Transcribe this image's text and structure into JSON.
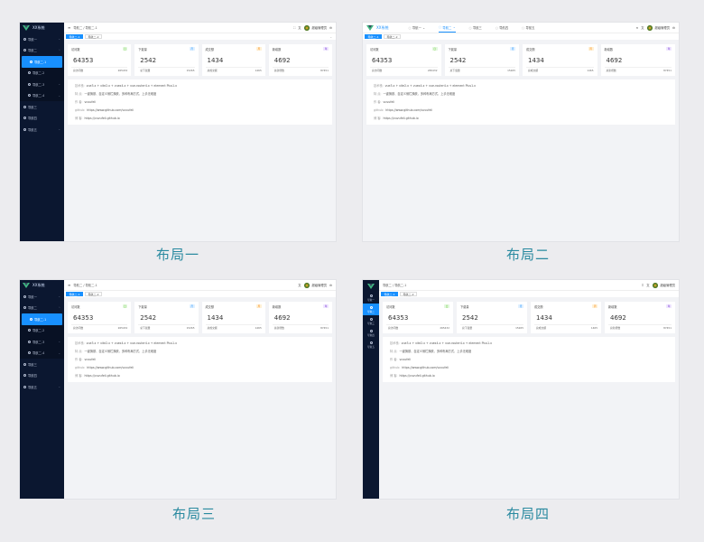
{
  "captions": [
    "布局一",
    "布局二",
    "布局三",
    "布局四"
  ],
  "logo_text": "XX系统",
  "menu": {
    "nav1": "导航一",
    "nav2": "导航二",
    "sub1": "导航二-1",
    "sub2": "导航二-2",
    "sub3": "导航二-3",
    "sub4": "导航二-4",
    "nav3": "导航三",
    "nav4": "导航四",
    "nav5": "导航五"
  },
  "breadcrumb": [
    "导航二",
    "导航二-1"
  ],
  "breadcrumb_sep": "/",
  "tabs": [
    "导航二-1",
    "导航二-2"
  ],
  "tabs2": [
    "导航二-1",
    "导航二-2"
  ],
  "user": "超级管理员",
  "cards": [
    {
      "title": "访问数",
      "badge": "日",
      "value": "64353",
      "foot_label": "总访问数",
      "foot_value": "265432",
      "badge_bg": "#e3f7df",
      "badge_fg": "#52c41a"
    },
    {
      "title": "下载量",
      "badge": "月",
      "value": "2542",
      "foot_label": "总下载量",
      "foot_value": "15265",
      "badge_bg": "#e0f0ff",
      "badge_fg": "#1890ff"
    },
    {
      "title": "成交额",
      "badge": "周",
      "value": "1434",
      "foot_label": "总成交额",
      "foot_value": "1465",
      "badge_bg": "#fff1d6",
      "badge_fg": "#fa8c16"
    },
    {
      "title": "新增数",
      "badge": "年",
      "value": "4692",
      "foot_label": "总新增数",
      "foot_value": "87451",
      "badge_bg": "#efe6ff",
      "badge_fg": "#722ed1"
    }
  ],
  "info": [
    {
      "label": "技术栈:",
      "value": "vue3.x + vite2.x + vuex4.x + vue-router4.x + element Plus1.x"
    },
    {
      "label": "特 点:",
      "value": "一键换肤、自定义侧栏换肤、多种布局方式、上手无难度"
    },
    {
      "label": "作 者:",
      "value": "vuvufeli"
    },
    {
      "label": "github:",
      "value": "https://www.github.com/vuvufeli"
    },
    {
      "label": "博 客:",
      "value": "https://vuvufeli.github.io"
    }
  ],
  "colors": {
    "accent": "#1890ff",
    "sidebar": "#0b1730",
    "caption": "#2a8aa0"
  }
}
